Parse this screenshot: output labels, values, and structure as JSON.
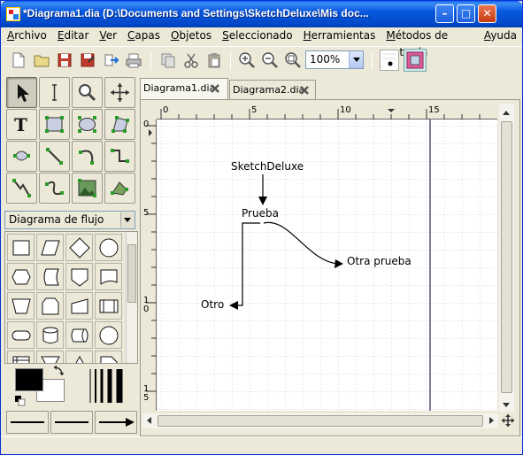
{
  "window": {
    "title": "*Diagrama1.dia (D:\\Documents and Settings\\SketchDeluxe\\Mis doc...",
    "minimize": "–",
    "maximize": "□",
    "close": "✕"
  },
  "menu": [
    {
      "pre": "",
      "u": "A",
      "post": "rchivo"
    },
    {
      "pre": "",
      "u": "E",
      "post": "ditar"
    },
    {
      "pre": "",
      "u": "V",
      "post": "er"
    },
    {
      "pre": "",
      "u": "C",
      "post": "apas"
    },
    {
      "pre": "",
      "u": "O",
      "post": "bjetos"
    },
    {
      "pre": "",
      "u": "S",
      "post": "eleccionado"
    },
    {
      "pre": "",
      "u": "H",
      "post": "erramientas"
    },
    {
      "pre": "",
      "u": "M",
      "post": "étodos de entrada"
    },
    {
      "pre": "",
      "u": "A",
      "post": "yuda"
    }
  ],
  "toolbar": {
    "icons": [
      "new-file-icon",
      "open-folder-icon",
      "save-icon",
      "save-as-icon",
      "export-icon",
      "print-icon",
      "copy-icon",
      "cut-icon",
      "paste-icon",
      "zoom-in-icon",
      "zoom-out-icon",
      "zoom-fit-icon"
    ],
    "zoom_value": "100%"
  },
  "tools": [
    "pointer-tool",
    "text-edit-tool",
    "magnify-tool",
    "scroll-tool",
    "text-tool",
    "box-tool",
    "ellipse-tool",
    "polygon-tool",
    "beziergon-tool",
    "line-tool",
    "arc-tool",
    "zigzag-tool",
    "polyline-tool",
    "bezier-tool",
    "image-tool",
    "outline-tool"
  ],
  "sheet": {
    "selected": "Diagrama de flujo"
  },
  "tabs": [
    {
      "label": "Diagrama1.dia"
    },
    {
      "label": "Diagrama2.dia"
    }
  ],
  "ruler": {
    "top_labels": [
      "0",
      "5",
      "10",
      "15"
    ],
    "left_labels": [
      "0",
      "5",
      "1\n0",
      "1\n5"
    ]
  },
  "diagram": {
    "nodes": {
      "top": "SketchDeluxe",
      "middle": "Prueba",
      "right": "Otra prueba",
      "left": "Otro"
    }
  },
  "colors": {
    "title_bar": "#0758e0",
    "foreground": "#000000",
    "background": "#ffffff",
    "grid": "#cfd6e2",
    "page_break": "#2a2a5a"
  }
}
